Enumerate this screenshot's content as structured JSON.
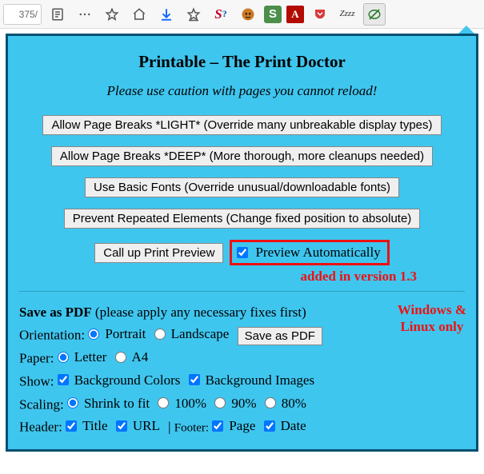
{
  "urlbar_fragment": "375/",
  "toolbar_icons": [
    "reader",
    "more",
    "bookmark-plus",
    "home",
    "download",
    "bookmark-star",
    "stylish",
    "tampermonkey",
    "session",
    "acrobat",
    "pocket",
    "sleep",
    "printable"
  ],
  "title": "Printable – The Print Doctor",
  "warning": "Please use caution with pages you cannot reload!",
  "btn_light": "Allow Page Breaks *LIGHT* (Override many unbreakable display types)",
  "btn_deep": "Allow Page Breaks *DEEP* (More thorough, more cleanups needed)",
  "btn_fonts": "Use Basic Fonts (Override unusual/downloadable fonts)",
  "btn_fixed": "Prevent Repeated Elements (Change fixed position to absolute)",
  "btn_preview": "Call up Print Preview",
  "cb_autopreview": "Preview Automatically",
  "added_note": "added in version 1.3",
  "pdf": {
    "header": "Save as PDF",
    "header_note": "(please apply any necessary fixes first)",
    "platform_note_1": "Windows &",
    "platform_note_2": "Linux only",
    "orientation_label": "Orientation:",
    "portrait": "Portrait",
    "landscape": "Landscape",
    "save_btn": "Save as PDF",
    "paper_label": "Paper:",
    "letter": "Letter",
    "a4": "A4",
    "show_label": "Show:",
    "bgcolors": "Background Colors",
    "bgimages": "Background Images",
    "scaling_label": "Scaling:",
    "shrink": "Shrink to fit",
    "s100": "100%",
    "s90": "90%",
    "s80": "80%",
    "hf_header": "Header:",
    "title": "Title",
    "url": "URL",
    "hf_footer": "Footer:",
    "page": "Page",
    "date": "Date"
  }
}
